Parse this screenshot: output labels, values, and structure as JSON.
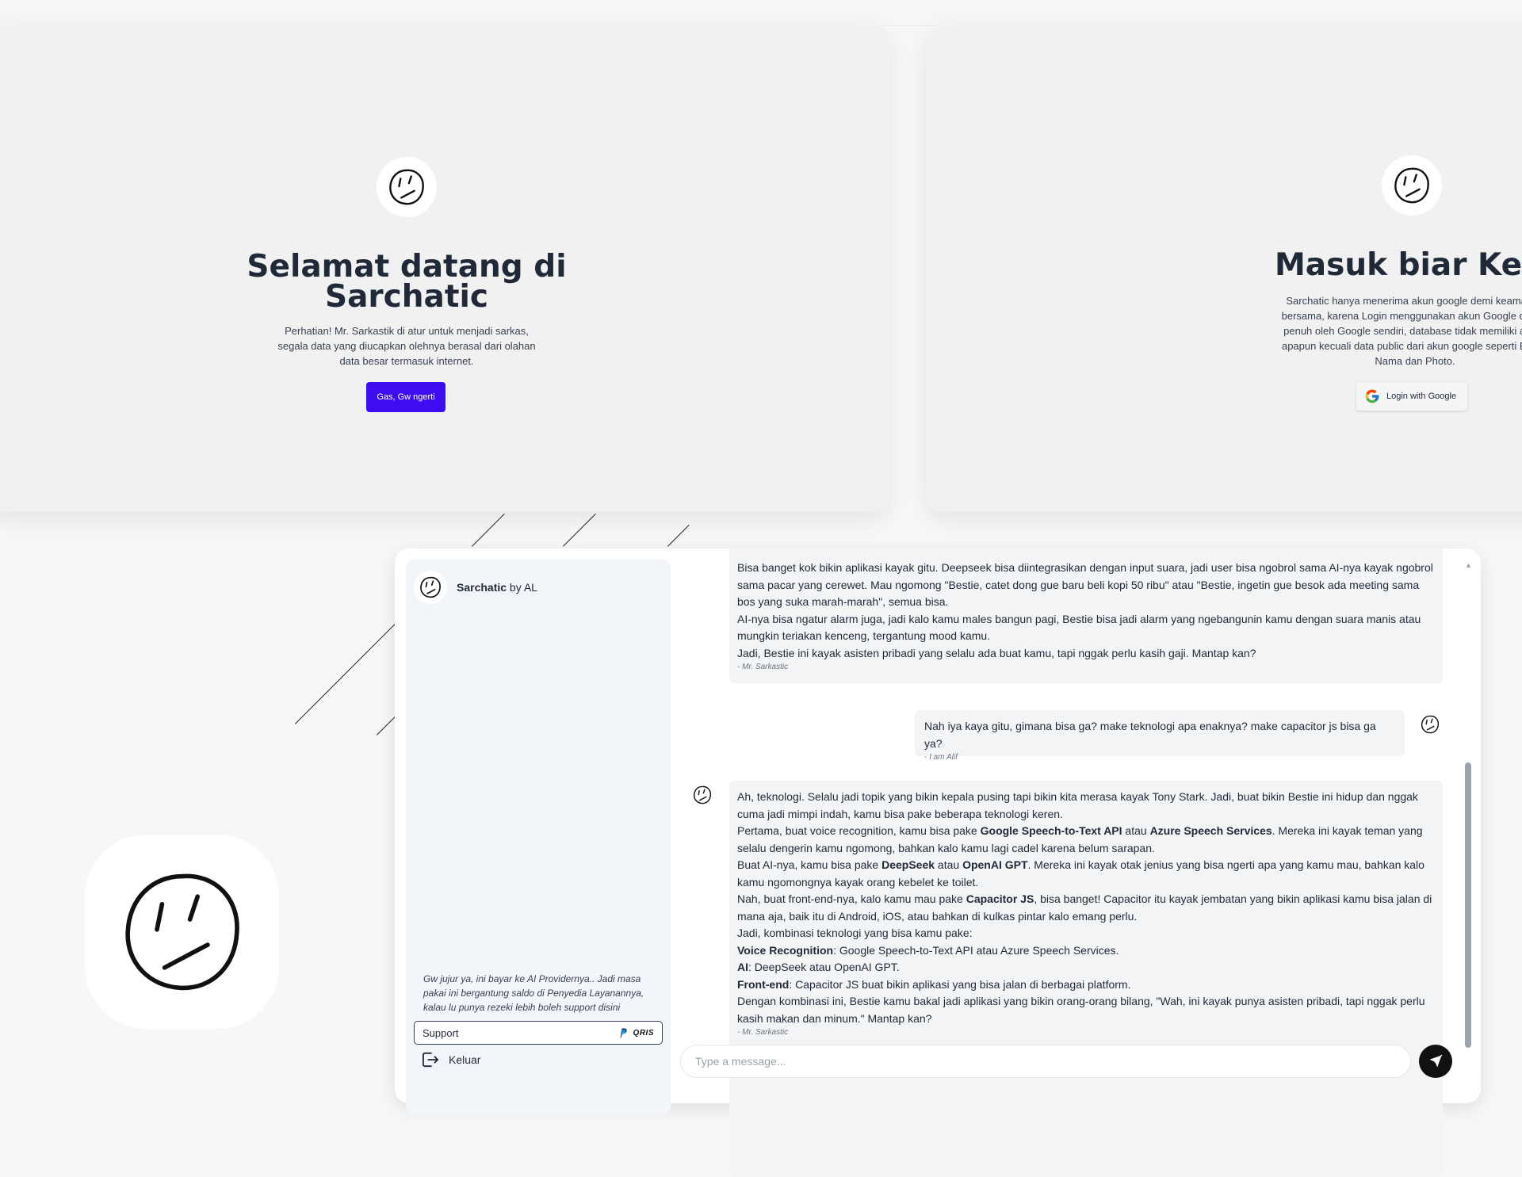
{
  "welcome": {
    "title": "Selamat datang di Sarchatic",
    "description": "Perhatian! Mr. Sarkastik di atur untuk menjadi sarkas, segala data yang diucapkan olehnya berasal dari olahan data besar termasuk internet.",
    "button_label": "Gas, Gw ngerti"
  },
  "login": {
    "title": "Masuk biar Kenal",
    "description": "Sarchatic hanya menerima akun google demi keamanan bersama, karena Login menggunakan akun Google diliputi penuh oleh Google sendiri, database tidak memiliki akses apapun kecuali data public dari akun google seperti Email, Nama dan Photo.",
    "google_button_label": "Login with Google"
  },
  "sidebar": {
    "brand_name": "Sarchatic",
    "brand_by": " by AL",
    "support_note": "Gw jujur ya, ini bayar ke AI Providernya.. Jadi masa pakai ini bergantung saldo di Penyedia Layanannya, kalau lu punya rezeki lebih boleh support disini",
    "support_label": "Support",
    "qris_label": "QRIS",
    "logout_label": "Keluar"
  },
  "chat": {
    "message_1": {
      "lines": [
        "Bisa banget kok bikin aplikasi kayak gitu. Deepseek bisa diintegrasikan dengan input suara, jadi user bisa ngobrol sama AI-nya kayak ngobrol sama pacar yang cerewet. Mau ngomong \"Bestie, catet dong gue baru beli kopi 50 ribu\" atau \"Bestie, ingetin gue besok ada meeting sama bos yang suka marah-marah\", semua bisa.",
        "AI-nya bisa ngatur alarm juga, jadi kalo kamu males bangun pagi, Bestie bisa jadi alarm yang ngebangunin kamu dengan suara manis atau mungkin teriakan kenceng, tergantung mood kamu.",
        "Jadi, Bestie ini kayak asisten pribadi yang selalu ada buat kamu, tapi nggak perlu kasih gaji. Mantap kan?"
      ],
      "signature": "- Mr. Sarkastic"
    },
    "message_2": {
      "text": "Nah iya kaya gitu, gimana bisa ga? make teknologi apa enaknya? make capacitor js bisa ga ya?",
      "signature": "- I am Alif"
    },
    "message_3": {
      "l1": "Ah, teknologi. Selalu jadi topik yang bikin kepala pusing tapi bikin kita merasa kayak Tony Stark. Jadi, buat bikin Bestie ini hidup dan nggak cuma jadi mimpi indah, kamu bisa pake beberapa teknologi keren.",
      "l2_a": "Pertama, buat voice recognition, kamu bisa pake ",
      "l2_b": "Google Speech-to-Text API",
      "l2_c": " atau ",
      "l2_d": "Azure Speech Services",
      "l2_e": ". Mereka ini kayak teman yang selalu dengerin kamu ngomong, bahkan kalo kamu lagi cadel karena belum sarapan.",
      "l3_a": "Buat AI-nya, kamu bisa pake ",
      "l3_b": "DeepSeek",
      "l3_c": " atau ",
      "l3_d": "OpenAI GPT",
      "l3_e": ". Mereka ini kayak otak jenius yang bisa ngerti apa yang kamu mau, bahkan kalo kamu ngomongnya kayak orang kebelet ke toilet.",
      "l4_a": "Nah, buat front-end-nya, kalo kamu mau pake ",
      "l4_b": "Capacitor JS",
      "l4_c": ", bisa banget! Capacitor itu kayak jembatan yang bikin aplikasi kamu bisa jalan di mana aja, baik itu di Android, iOS, atau bahkan di kulkas pintar kalo emang perlu.",
      "l5": "Jadi, kombinasi teknologi yang bisa kamu pake:",
      "l6_a": "Voice Recognition",
      "l6_b": ": Google Speech-to-Text API atau Azure Speech Services.",
      "l7_a": "AI",
      "l7_b": ": DeepSeek atau OpenAI GPT.",
      "l8_a": "Front-end",
      "l8_b": ": Capacitor JS buat bikin aplikasi yang bisa jalan di berbagai platform.",
      "l9": "Dengan kombinasi ini, Bestie kamu bakal jadi aplikasi yang bikin orang-orang bilang, \"Wah, ini kayak punya asisten pribadi, tapi nggak perlu kasih makan dan minum.\" Mantap kan?",
      "signature": "- Mr. Sarkastic"
    },
    "input_placeholder": "Type a message..."
  },
  "icons": {
    "logo": "smiley-face-icon",
    "google": "google-g-icon",
    "paypal": "paypal-icon",
    "logout": "logout-icon",
    "send": "send-icon"
  },
  "colors": {
    "primary_button": "#3d0cf0",
    "card_background": "#f1f1f1",
    "sidebar_background": "#f2f5f9",
    "message_background": "#f3f4f6",
    "send_button": "#111111"
  }
}
